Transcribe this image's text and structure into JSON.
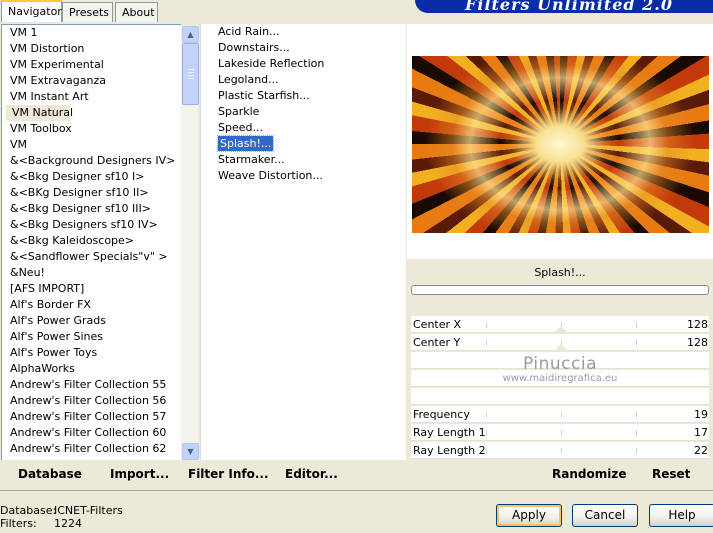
{
  "tabs": [
    {
      "label": "Navigator",
      "active": true
    },
    {
      "label": "Presets",
      "active": false
    },
    {
      "label": "About",
      "active": false
    }
  ],
  "banner": {
    "title": "Filters Unlimited 2.0"
  },
  "categories": {
    "selected": "VM Natural",
    "items": [
      "VM 1",
      "VM Distortion",
      "VM Experimental",
      "VM Extravaganza",
      "VM Instant Art",
      "VM Natural",
      "VM Toolbox",
      "VM",
      "&<Background Designers IV>",
      "&<Bkg Designer sf10 I>",
      "&<BKg Designer sf10 II>",
      "&<Bkg Designer sf10 III>",
      "&<Bkg Designers sf10 IV>",
      "&<Bkg Kaleidoscope>",
      "&<Sandflower Specials\"v\" >",
      "&Neu!",
      "[AFS IMPORT]",
      "Alf's Border FX",
      "Alf's Power Grads",
      "Alf's Power Sines",
      "Alf's Power Toys",
      "AlphaWorks",
      "Andrew's Filter Collection 55",
      "Andrew's Filter Collection 56",
      "Andrew's Filter Collection 57",
      "Andrew's Filter Collection 60",
      "Andrew's Filter Collection 62"
    ]
  },
  "filters": {
    "selected": "Splash!...",
    "items": [
      "Acid Rain...",
      "Downstairs...",
      "Lakeside Reflection",
      "Legoland...",
      "Plastic Starfish...",
      "Sparkle",
      "Speed...",
      "Splash!...",
      "Starmaker...",
      "Weave Distortion..."
    ]
  },
  "preview": {
    "filter_name": "Splash!...",
    "progress_percent": 0
  },
  "parameters": {
    "center_x": {
      "label": "Center X",
      "value": "128"
    },
    "center_y": {
      "label": "Center Y",
      "value": "128"
    },
    "frequency": {
      "label": "Frequency",
      "value": "19"
    },
    "ray_length_1": {
      "label": "Ray Length 1",
      "value": "17"
    },
    "ray_length_2": {
      "label": "Ray Length 2",
      "value": "22"
    }
  },
  "watermark": {
    "line1": "Pinuccia",
    "line2": "www.maidiregrafica.eu"
  },
  "toolbar_left": {
    "database": "Database",
    "import": "Import...",
    "filter_info": "Filter Info...",
    "editor": "Editor..."
  },
  "toolbar_right": {
    "randomize": "Randomize",
    "reset": "Reset"
  },
  "status": {
    "database_label": "Database:",
    "database_value": "ICNET-Filters",
    "filters_label": "Filters:",
    "filters_value": "1224"
  },
  "buttons": {
    "apply": "Apply",
    "cancel": "Cancel",
    "help": "Help"
  },
  "colors": {
    "selection": "#316ac5",
    "dialog_bg": "#ece9d8",
    "banner": "#0a2ca8"
  }
}
